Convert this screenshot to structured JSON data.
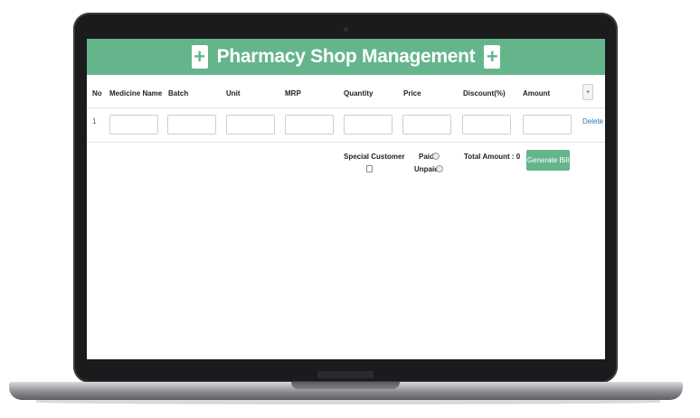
{
  "app": {
    "title": "Pharmacy Shop Management",
    "header_color": "#64b58b",
    "header_icon": "plus-medical-icon"
  },
  "table": {
    "columns": [
      "No",
      "Medicine Name",
      "Batch",
      "Unit",
      "MRP",
      "Quantity",
      "Price",
      "Discount(%)",
      "Amount"
    ],
    "add_row_label": "+",
    "rows": [
      {
        "no": "1",
        "medicine_name": "",
        "batch": "",
        "unit": "",
        "mrp": "",
        "quantity": "",
        "price": "",
        "discount": "",
        "amount": "",
        "delete_label": "Delete"
      }
    ]
  },
  "footer": {
    "special_customer_label": "Special Customer",
    "special_customer_checked": false,
    "paid_label": "Paid",
    "unpaid_label": "Unpaid",
    "total_amount_label": "Total Amount : 0",
    "generate_bill_label": "Generate Bill"
  }
}
